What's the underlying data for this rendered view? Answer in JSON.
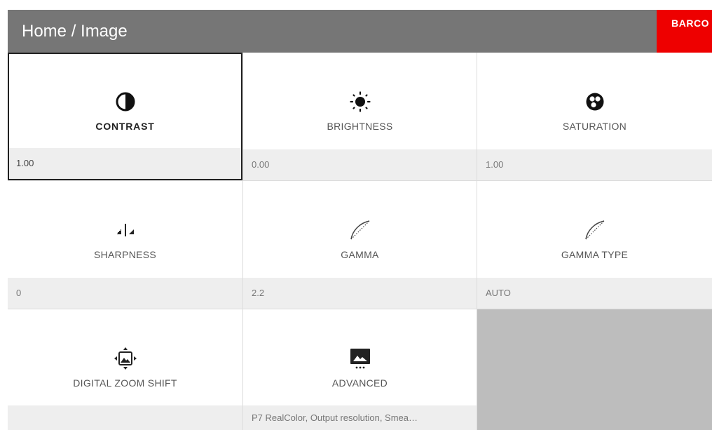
{
  "header": {
    "breadcrumb": "Home / Image",
    "logo_text": "BARCO"
  },
  "tiles": [
    {
      "label": "CONTRAST",
      "value": "1.00",
      "icon": "contrast-icon"
    },
    {
      "label": "BRIGHTNESS",
      "value": "0.00",
      "icon": "brightness-icon"
    },
    {
      "label": "SATURATION",
      "value": "1.00",
      "icon": "saturation-icon"
    },
    {
      "label": "SHARPNESS",
      "value": "0",
      "icon": "sharpness-icon"
    },
    {
      "label": "GAMMA",
      "value": "2.2",
      "icon": "gamma-icon"
    },
    {
      "label": "GAMMA TYPE",
      "value": "AUTO",
      "icon": "gamma-icon"
    },
    {
      "label": "DIGITAL ZOOM SHIFT",
      "value": "",
      "icon": "zoom-shift-icon"
    },
    {
      "label": "ADVANCED",
      "value": "P7 RealColor, Output resolution, Smea…",
      "icon": "advanced-image-icon"
    }
  ],
  "colors": {
    "header": "#767676",
    "brand": "#ee0000",
    "selected_border": "#222222",
    "value_bg": "#eeeeee"
  }
}
